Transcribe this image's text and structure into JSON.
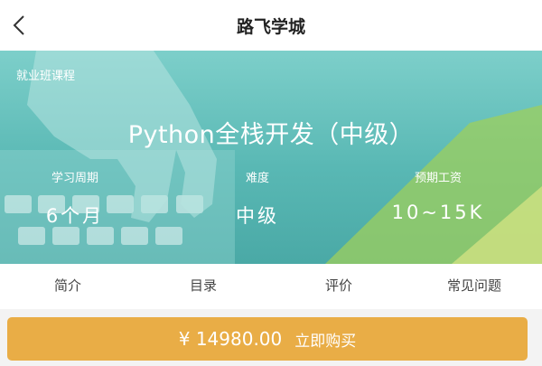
{
  "header": {
    "title": "路飞学城"
  },
  "banner": {
    "course_type": "就业班课程",
    "course_title": "Python全栈开发（中级）",
    "stats": [
      {
        "label": "学习周期",
        "value": "6个月"
      },
      {
        "label": "难度",
        "value": "中级"
      },
      {
        "label": "预期工资",
        "value": "10~15K"
      }
    ]
  },
  "tabs": [
    {
      "label": "简介"
    },
    {
      "label": "目录"
    },
    {
      "label": "评价"
    },
    {
      "label": "常见问题"
    }
  ],
  "buy": {
    "price": "¥ 14980.00",
    "label": "立即购买"
  },
  "colors": {
    "accent": "#e9ad46",
    "banner": "#5bb8b4"
  },
  "icons": {
    "back": "chevron-left-icon"
  }
}
